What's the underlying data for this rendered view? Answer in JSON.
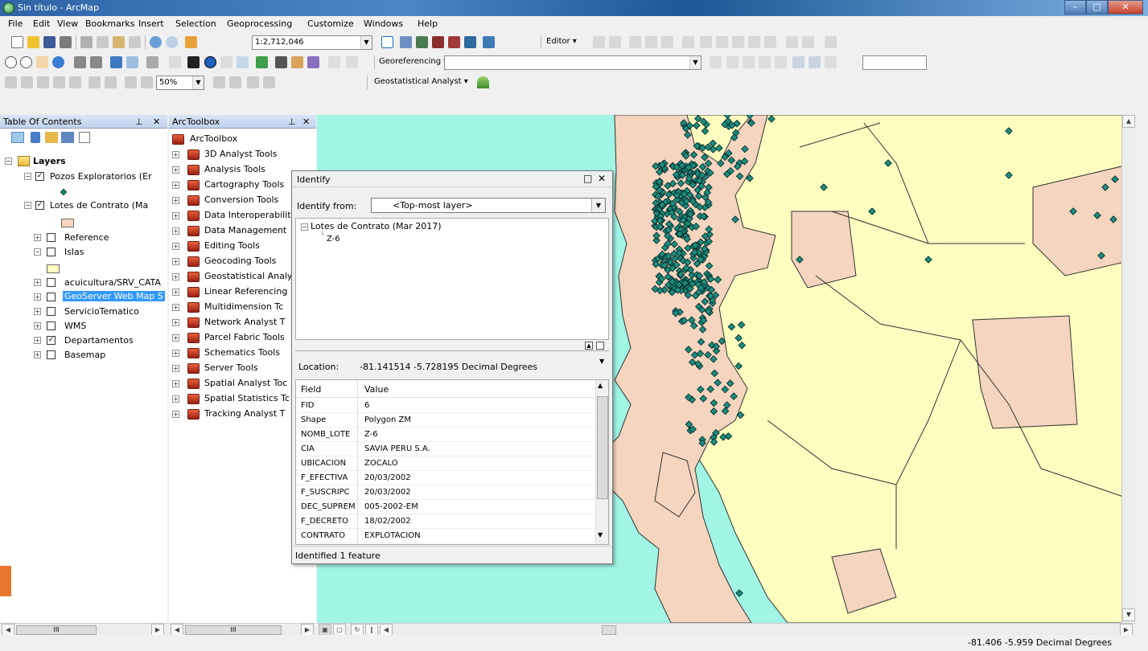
{
  "window": {
    "title": "Sin título - ArcMap"
  },
  "menu": [
    "File",
    "Edit",
    "View",
    "Bookmarks",
    "Insert",
    "Selection",
    "Geoprocessing",
    "Customize",
    "Windows",
    "Help"
  ],
  "toolbar": {
    "scale": "1:2,712,046",
    "editor_label": "Editor ▾",
    "georef_label": "Georeferencing ▾",
    "zoom_pct": "50%",
    "geostat_label": "Geostatistical Analyst ▾"
  },
  "toc": {
    "title": "Table Of Contents",
    "root": "Layers",
    "layers": [
      {
        "label": "Pozos Exploratorios (Er",
        "checked": true
      },
      {
        "label": "Lotes de Contrato (Ma",
        "checked": true
      },
      {
        "label": "Reference",
        "checked": false
      },
      {
        "label": "Islas",
        "checked": false
      },
      {
        "label": "acuicultura/SRV_CATA",
        "checked": false
      },
      {
        "label": "GeoServer Web Map S",
        "checked": false
      },
      {
        "label": "ServicioTematico",
        "checked": false
      },
      {
        "label": "WMS",
        "checked": false
      },
      {
        "label": "Departamentos",
        "checked": true
      },
      {
        "label": "Basemap",
        "checked": false
      }
    ],
    "colors": {
      "lotes": "#f5d5bf",
      "islas": "#fdfdc0",
      "pozos": "#1c8c7c",
      "selected": "#3399ff"
    }
  },
  "toolbox": {
    "title": "ArcToolbox",
    "root": "ArcToolbox",
    "items": [
      "3D Analyst Tools",
      "Analysis Tools",
      "Cartography Tools",
      "Conversion Tools",
      "Data Interoperabilit",
      "Data Management",
      "Editing Tools",
      "Geocoding Tools",
      "Geostatistical Analy",
      "Linear Referencing",
      "Multidimension Tc",
      "Network Analyst T",
      "Parcel Fabric Tools",
      "Schematics Tools",
      "Server Tools",
      "Spatial Analyst Toc",
      "Spatial Statistics Tc",
      "Tracking Analyst T"
    ]
  },
  "identify": {
    "title": "Identify",
    "from_label": "Identify from:",
    "from_value": "<Top-most layer>",
    "tree_layer": "Lotes de Contrato (Mar 2017)",
    "tree_feature": "Z-6",
    "location_label": "Location:",
    "location_value": "-81.141514  -5.728195 Decimal Degrees",
    "col_field": "Field",
    "col_value": "Value",
    "rows": [
      {
        "field": "FID",
        "value": "6"
      },
      {
        "field": "Shape",
        "value": "Polygon ZM"
      },
      {
        "field": "NOMB_LOTE",
        "value": "Z-6"
      },
      {
        "field": "CIA",
        "value": "SAVIA PERU S.A."
      },
      {
        "field": "UBICACION",
        "value": "ZOCALO"
      },
      {
        "field": "F_EFECTIVA",
        "value": "20/03/2002"
      },
      {
        "field": "F_SUSCRIPC",
        "value": "20/03/2002"
      },
      {
        "field": "DEC_SUPREM",
        "value": "005-2002-EM"
      },
      {
        "field": "F_DECRETO",
        "value": "18/02/2002"
      },
      {
        "field": "CONTRATO",
        "value": "EXPLOTACION"
      }
    ],
    "status": "Identified 1 feature"
  },
  "map_colors": {
    "sea": "#a0f5e4",
    "land": "#fdfdc0",
    "lotes": "#f5d5bf",
    "wells": "#1c8c7c"
  },
  "status": {
    "coords": "-81.406  -5.959 Decimal Degrees"
  }
}
